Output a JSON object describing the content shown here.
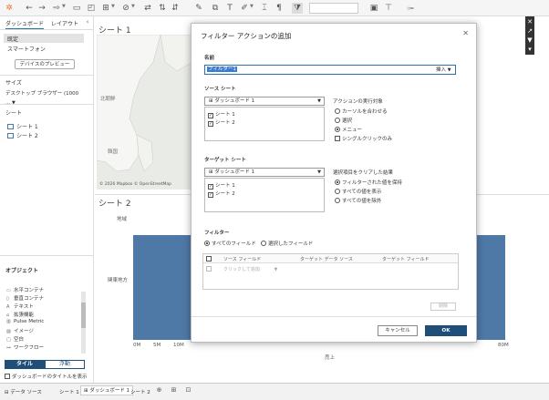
{
  "toolbar": {
    "icons": [
      "tableau-logo-icon",
      "back-icon",
      "forward-icon",
      "redo-icon",
      "save-icon",
      "new-datasource-icon",
      "new-sheet-icon",
      "clear-icon",
      "swap-icon",
      "sort-asc-icon",
      "sort-desc-icon",
      "highlight-icon",
      "group-icon",
      "label-icon",
      "format-icon",
      "fit-icon",
      "show-labels-icon",
      "filter-icon"
    ]
  },
  "left_pane": {
    "tabs": [
      "ダッシュボード",
      "レイアウト"
    ],
    "devices": [
      "既定",
      "スマートフォン"
    ],
    "preview_button": "デバイスのプレビュー",
    "size_title": "サイズ",
    "size_value": "デスクトップ ブラウザー (1000 ...",
    "sheets_title": "シート",
    "sheets": [
      "シート 1",
      "シート 2"
    ],
    "objects_title": "オブジェクト",
    "objects": [
      {
        "icon": "horizontal-container-icon",
        "label": "水平コンテナ"
      },
      {
        "icon": "vertical-container-icon",
        "label": "垂直コンテナ"
      },
      {
        "icon": "text-icon",
        "label": "テキスト"
      },
      {
        "icon": "extension-icon",
        "label": "拡張機能"
      },
      {
        "icon": "pulse-metric-icon",
        "label": "Pulse Metric"
      },
      {
        "icon": "image-icon",
        "label": "イメージ"
      },
      {
        "icon": "blank-icon",
        "label": "空白"
      },
      {
        "icon": "workflow-icon",
        "label": "ワークフロー"
      }
    ],
    "tile_label": "タイル",
    "float_label": "浮動",
    "show_title_label": "ダッシュボードのタイトルを表示"
  },
  "main": {
    "sheet1_title": "シート 1",
    "sheet2_title": "シート 2",
    "map_labels": [
      "北朝鮮",
      "韓国"
    ],
    "map_credit": "© 2026 Mapbox © OpenStreetMap",
    "chart_row_top": "地域",
    "chart_row_label": "関東地方",
    "x_axis_ticks": [
      "0M",
      "5M",
      "10M",
      "80M"
    ],
    "x_axis_label": "売上"
  },
  "dialog": {
    "title": "フィルター アクションの追加",
    "name_label": "名前",
    "name_value": "フィルター1",
    "insert_label": "挿入",
    "source_label": "ソース シート",
    "source_select": "ダッシュボード 1",
    "source_sheets": [
      "シート 1",
      "シート 2"
    ],
    "run_action_label": "アクションの実行対象",
    "run_options": [
      "カーソルを合わせる",
      "選択",
      "メニュー"
    ],
    "run_selected": "メニュー",
    "single_select_label": "シングルクリックのみ",
    "target_label": "ターゲット シート",
    "target_select": "ダッシュボード 1",
    "target_sheets": [
      "シート 1",
      "シート 2"
    ],
    "clear_label": "選択項目をクリアした結果",
    "clear_options": [
      "フィルターされた値を保持",
      "すべての値を表示",
      "すべての値を除外"
    ],
    "clear_selected": "フィルターされた値を保持",
    "filter_label": "フィルター",
    "filter_options": [
      "すべてのフィールド",
      "選択したフィールド"
    ],
    "filter_selected": "すべてのフィールド",
    "table_columns": [
      "ソース フィールド",
      "ターゲット データ ソース",
      "ターゲット フィールド"
    ],
    "table_placeholder": "クリックして追加",
    "delete_label": "削除",
    "cancel_label": "キャンセル",
    "ok_label": "OK"
  },
  "bottom_bar": {
    "datasource_label": "データ ソース",
    "tabs": [
      "シート 1",
      "ダッシュボード 1",
      "シート 2"
    ],
    "active_tab": "ダッシュボード 1"
  },
  "colors": {
    "bar": "#4e79a7",
    "primary_button": "#1f4e79",
    "name_highlight": "#3a7bd5"
  }
}
